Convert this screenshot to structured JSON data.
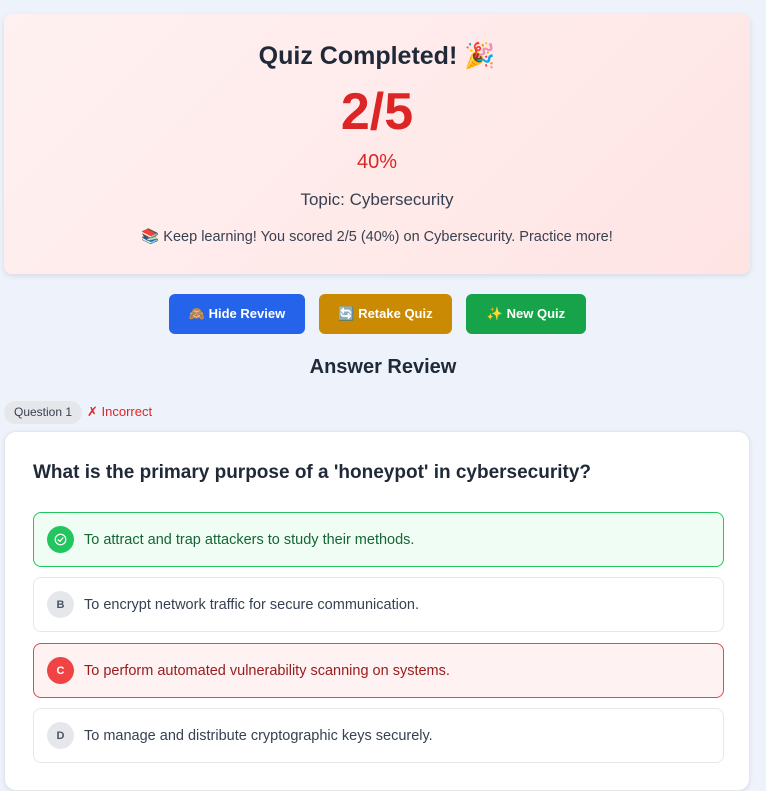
{
  "result": {
    "title": "Quiz Completed! 🎉",
    "score": "2/5",
    "percent": "40%",
    "topic": "Topic: Cybersecurity",
    "message": "📚 Keep learning! You scored 2/5 (40%) on Cybersecurity. Practice more!"
  },
  "actions": {
    "hide_review": "🙈 Hide Review",
    "retake": "🔄 Retake Quiz",
    "new_quiz": "✨ New Quiz"
  },
  "review": {
    "heading": "Answer Review",
    "questions": [
      {
        "badge": "Question 1",
        "status": "✗ Incorrect",
        "text": "What is the primary purpose of a 'honeypot' in cybersecurity?",
        "options": [
          {
            "marker": "✓",
            "text": "To attract and trap attackers to study their methods.",
            "state": "correct"
          },
          {
            "marker": "B",
            "text": "To encrypt network traffic for secure communication.",
            "state": "neutral"
          },
          {
            "marker": "C",
            "text": "To perform automated vulnerability scanning on systems.",
            "state": "selected-wrong"
          },
          {
            "marker": "D",
            "text": "To manage and distribute cryptographic keys securely.",
            "state": "neutral"
          }
        ]
      }
    ]
  },
  "colors": {
    "primary_blue": "#2563eb",
    "retake_gold": "#ca8a04",
    "new_green": "#16a34a",
    "score_red": "#dc2626",
    "correct_green": "#22c55e",
    "wrong_red": "#ef4444"
  }
}
